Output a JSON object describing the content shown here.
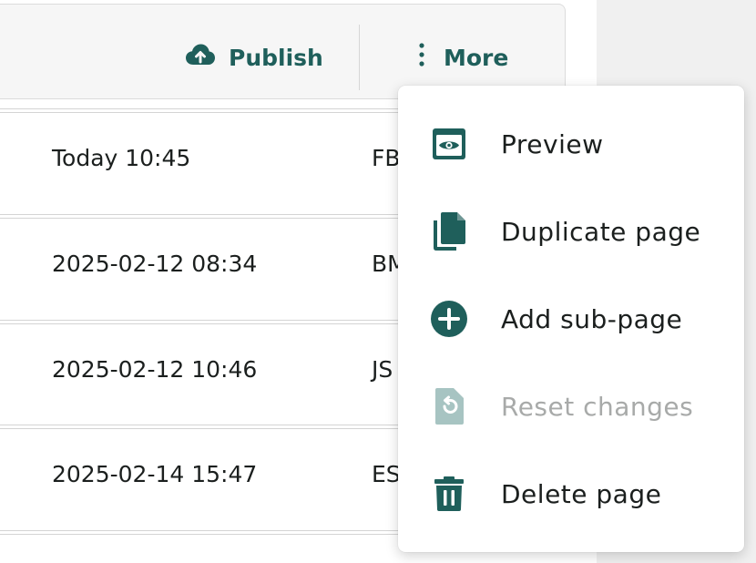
{
  "colors": {
    "accent": "#1f5f5b",
    "text": "#1b1f1e",
    "disabled": "#a8aaa9",
    "disabled_icon": "#a7c4c2"
  },
  "toolbar": {
    "publish_label": "Publish",
    "publish_icon": "cloud-upload-icon",
    "more_label": "More",
    "more_icon": "vertical-dots-icon"
  },
  "rows": [
    {
      "modified": "Today 10:45",
      "user": "FB"
    },
    {
      "modified": "2025-02-12 08:34",
      "user": "BM"
    },
    {
      "modified": "2025-02-12 10:46",
      "user": "JS"
    },
    {
      "modified": "2025-02-14 15:47",
      "user": "ES"
    }
  ],
  "menu": {
    "items": [
      {
        "label": "Preview",
        "icon": "eye-icon",
        "enabled": true
      },
      {
        "label": "Duplicate page",
        "icon": "copy-icon",
        "enabled": true
      },
      {
        "label": "Add sub-page",
        "icon": "plus-circle-icon",
        "enabled": true
      },
      {
        "label": "Reset changes",
        "icon": "reset-icon",
        "enabled": false
      },
      {
        "label": "Delete page",
        "icon": "trash-icon",
        "enabled": true
      }
    ]
  }
}
